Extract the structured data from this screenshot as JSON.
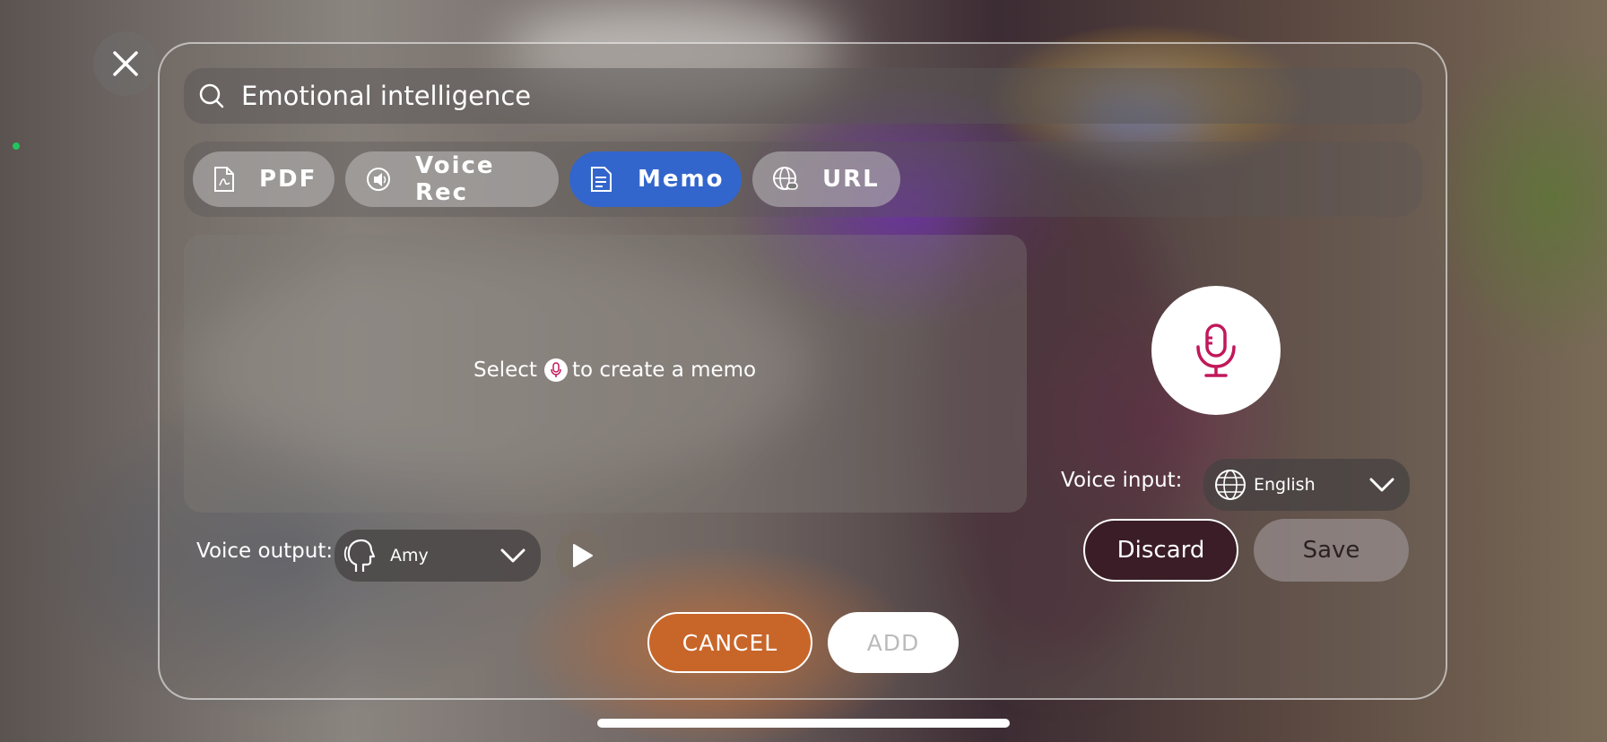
{
  "search": {
    "value": "Emotional intelligence"
  },
  "tabs": [
    {
      "label": "PDF",
      "icon": "pdf-icon",
      "active": false
    },
    {
      "label": "Voice Rec",
      "icon": "voice-rec-icon",
      "active": false
    },
    {
      "label": "Memo",
      "icon": "memo-icon",
      "active": true
    },
    {
      "label": "URL",
      "icon": "globe-link-icon",
      "active": false
    }
  ],
  "memo": {
    "hint_before": "Select",
    "hint_after": "to create a memo"
  },
  "voice_input": {
    "label": "Voice input:",
    "selected": "English"
  },
  "voice_output": {
    "label": "Voice output:",
    "selected": "Amy"
  },
  "actions": {
    "discard": "Discard",
    "save": "Save",
    "cancel": "CANCEL",
    "add": "ADD"
  },
  "colors": {
    "accent": "#3366cc",
    "mic": "#c2185b",
    "cancel": "#c8662a",
    "discard": "#3a1d26"
  }
}
